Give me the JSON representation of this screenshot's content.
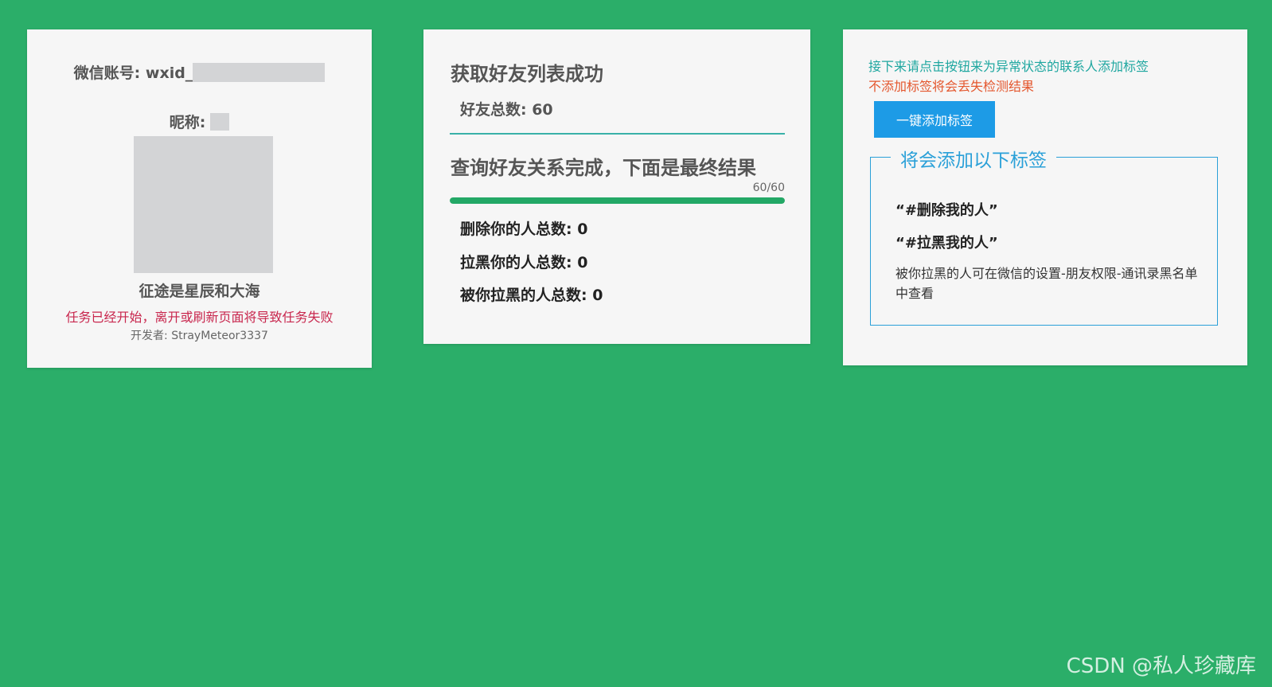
{
  "account_card": {
    "wechat_account_label": "微信账号: wxid_",
    "nickname_label": "昵称:",
    "slogan": "征途是星辰和大海",
    "warning": "任务已经开始，离开或刷新页面将导致任务失败",
    "developer": "开发者: StrayMeteor3337"
  },
  "progress_card": {
    "fetch_title": "获取好友列表成功",
    "friend_total": "好友总数: 60",
    "query_title": "查询好友关系完成，下面是最终结果",
    "progress_text": "60/60",
    "progress_value": 1.0,
    "deleted_total": "删除你的人总数: 0",
    "blocked_you_total": "拉黑你的人总数: 0",
    "blocked_by_you_total": "被你拉黑的人总数: 0"
  },
  "tags_card": {
    "tip_line1": "接下来请点击按钮来为异常状态的联系人添加标签",
    "tip_line2": "不添加标签将会丢失检测结果",
    "add_button_label": "一键添加标签",
    "legend": "将会添加以下标签",
    "tags": [
      "“#删除我的人”",
      "“#拉黑我的人”"
    ],
    "note": "被你拉黑的人可在微信的设置-朋友权限-通讯录黑名单中查看"
  },
  "watermark": "CSDN @私人珍藏库",
  "colors": {
    "background": "#2bae69",
    "card": "#f6f6f6",
    "warning": "#c8264d",
    "tip_teal": "#1fa7a0",
    "tip_orange": "#e4572e",
    "button": "#1d9be6",
    "progress": "#23a866"
  }
}
